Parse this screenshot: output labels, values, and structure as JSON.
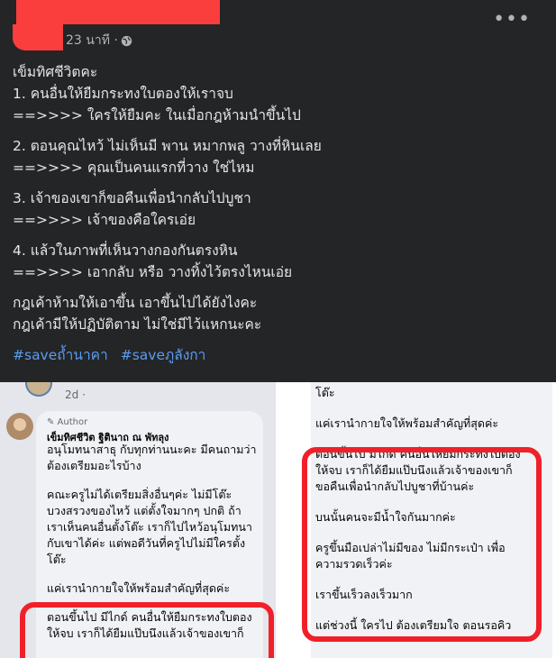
{
  "post": {
    "time": "23 นาที ·",
    "more_label": "•••",
    "blocks": [
      [
        "เข็มทิศชีวิตคะ",
        "1. คนอื่นให้ยืมกระทงใบตองให้เราจบ",
        "==>>>> ใครให้ยืมคะ ในเมื่อกฎห้ามนำขึ้นไป"
      ],
      [
        "2. ตอนคุณไหว้ ไม่เห็นมี พาน หมากพลู วางที่หินเลย",
        "==>>>> คุณเป็นคนแรกที่วาง ใช่ไหม"
      ],
      [
        "3. เจ้าของเขาก็ขอคืนเพื่อนำกลับไปบูชา",
        "==>>>> เจ้าของคือใครเอ่ย"
      ],
      [
        "4. แล้วในภาพที่เห็นวางกองกันตรงหิน",
        "==>>>> เอากลับ หรือ วางทิ้งไว้ตรงไหนเอ่ย"
      ],
      [
        "กฎเค้าห้ามให้เอาขึ้น เอาขึ้นไปได้ยังไงคะ",
        "กฎเค้ามีให้ปฏิบัติตาม ไม่ใช่มีไว้แหกนะคะ"
      ]
    ],
    "hashtags": [
      "#saveถ้ำนาคา",
      "#saveภูลังกา"
    ]
  },
  "left_shot": {
    "time": "2d ·",
    "author_badge": "✎ Author",
    "commenter": "เข็มทิศชีวิต ฐิตินาถ ณ พัทลุง",
    "lines": [
      "อนุโมทนาสาธุ กับทุกท่านนะคะ มีคนถามว่า",
      "ต้องเตรียมอะไรบ้าง",
      "",
      "คณะครูไม่ได้เตรียมสิ่งอื่นๆค่ะ ไม่มีโต๊ะ",
      "บวงสรวงของไหว้ แต่ตั้งใจมากๆ ปกติ ถ้า",
      "เราเห็นคนอื่นตั้งโต๊ะ เราก็ไปไหว้อนุโมทนา",
      "กับเขาได้ค่ะ แต่พอดีวันที่ครูไปไม่มีใครตั้ง",
      "โต๊ะ",
      "",
      "แค่เรานำกายใจให้พร้อมสำคัญที่สุดค่ะ",
      "",
      "ตอนขึ้นไป มีไกด์ คนอื่นให้ยืมกระทงใบตอง",
      "ให้จบ เราก็ได้ยืมแป๊บนึงแล้วเจ้าของเขาก็"
    ]
  },
  "right_shot": {
    "lines": [
      "โต๊ะ",
      "",
      "แค่เรานำกายใจให้พร้อมสำคัญที่สุดค่ะ",
      "",
      "ตอนขึ้นไป มีไกด์ คนอื่นให้ยืมกระทงใบตอง",
      "ให้จบ เราก็ได้ยืมแป๊บนึงแล้วเจ้าของเขาก็",
      "ขอคืนเพื่อนำกลับไปบูชาที่บ้านค่ะ",
      "",
      "บนนั้นคนจะมีน้ำใจกันมากค่ะ",
      "",
      "ครูขึ้นมือเปล่าไม่มีของ ไม่มีกระเป๋า เพื่อ",
      "ความรวดเร็วค่ะ",
      "",
      "เราขึ้นเร็วลงเร็วมาก",
      "",
      "แต่ช่วงนี้ ใครไป ต้องเตรียมใจ ตอนรอคิว"
    ]
  },
  "colors": {
    "annotation_red": "#f0202a",
    "hashtag_blue": "#5b9cf2",
    "post_bg": "#242526"
  }
}
